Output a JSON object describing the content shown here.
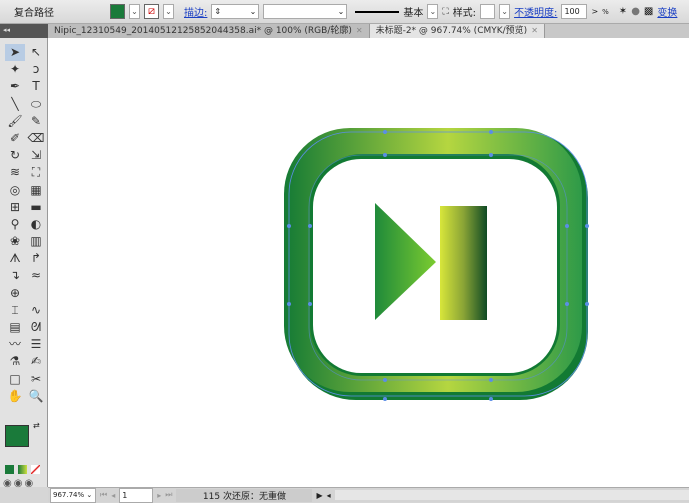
{
  "control_bar": {
    "object_type": "复合路径",
    "fill_color": "#1a7a3a",
    "stroke_label": "描边:",
    "stroke_weight": "",
    "stroke_profile": "",
    "brush_label": "基本",
    "style_label": "样式:",
    "opacity_label": "不透明度:",
    "opacity_value": "100",
    "percent": "%",
    "transform_label": "变换"
  },
  "tabs": [
    {
      "label": "Nipic_12310549_20140512125852044358.ai* @ 100% (RGB/轮廓)",
      "active": false
    },
    {
      "label": "未标题-2* @ 967.74% (CMYK/预览)",
      "active": true
    }
  ],
  "toolbar": {
    "collapse": "◂◂",
    "tools": [
      {
        "name": "selection",
        "glyph": "➤"
      },
      {
        "name": "direct-selection",
        "glyph": "↖"
      },
      {
        "name": "magic-wand",
        "glyph": "✦"
      },
      {
        "name": "lasso",
        "glyph": "ↄ"
      },
      {
        "name": "pen",
        "glyph": "✒"
      },
      {
        "name": "type",
        "glyph": "T"
      },
      {
        "name": "line-segment",
        "glyph": "╲"
      },
      {
        "name": "ellipse",
        "glyph": "⬭"
      },
      {
        "name": "paintbrush",
        "glyph": "🖌"
      },
      {
        "name": "pencil",
        "glyph": "✎"
      },
      {
        "name": "blob-brush",
        "glyph": "✐"
      },
      {
        "name": "eraser",
        "glyph": "⌫"
      },
      {
        "name": "rotate",
        "glyph": "↻"
      },
      {
        "name": "scale",
        "glyph": "⇲"
      },
      {
        "name": "warp",
        "glyph": "≋"
      },
      {
        "name": "free-transform",
        "glyph": "⛶"
      },
      {
        "name": "shape-builder",
        "glyph": "◎"
      },
      {
        "name": "perspective-grid",
        "glyph": "▦"
      },
      {
        "name": "mesh",
        "glyph": "⊞"
      },
      {
        "name": "gradient",
        "glyph": "▬"
      },
      {
        "name": "eyedropper",
        "glyph": "⚲"
      },
      {
        "name": "blend",
        "glyph": "◐"
      },
      {
        "name": "symbol-sprayer",
        "glyph": "❀"
      },
      {
        "name": "column-graph",
        "glyph": "▥"
      },
      {
        "name": "custom-a",
        "glyph": "ᗑ"
      },
      {
        "name": "custom-b",
        "glyph": "↱"
      },
      {
        "name": "custom-c",
        "glyph": "↴"
      },
      {
        "name": "custom-d",
        "glyph": "≈"
      },
      {
        "name": "crosshair",
        "glyph": "⊕"
      },
      {
        "name": "empty",
        "glyph": ""
      },
      {
        "name": "envelope",
        "glyph": "⌶"
      },
      {
        "name": "wave",
        "glyph": "∿"
      },
      {
        "name": "grid",
        "glyph": "▤"
      },
      {
        "name": "chameleon",
        "glyph": "ᘛ"
      },
      {
        "name": "squiggle",
        "glyph": "〰"
      },
      {
        "name": "list",
        "glyph": "☰"
      },
      {
        "name": "dropper-bar",
        "glyph": "⚗"
      },
      {
        "name": "pen-bar",
        "glyph": "✍"
      },
      {
        "name": "artboard",
        "glyph": "□"
      },
      {
        "name": "slice",
        "glyph": "✂"
      },
      {
        "name": "hand",
        "glyph": "✋"
      },
      {
        "name": "zoom",
        "glyph": "🔍"
      }
    ]
  },
  "colors": {
    "fill": "#1a7a3a",
    "stroke": "none"
  },
  "status": {
    "zoom": "967.74%",
    "page": "1",
    "message": "115 次还原：无重做"
  },
  "artwork": {
    "ring_dark": "#147a35",
    "ring_light": "#b5d640",
    "triangle": [
      "#1f8a3a",
      "#7ccc30"
    ],
    "bar": [
      "#d8e63a",
      "#0f4a24"
    ],
    "anchor_color": "#5b8ee6"
  }
}
